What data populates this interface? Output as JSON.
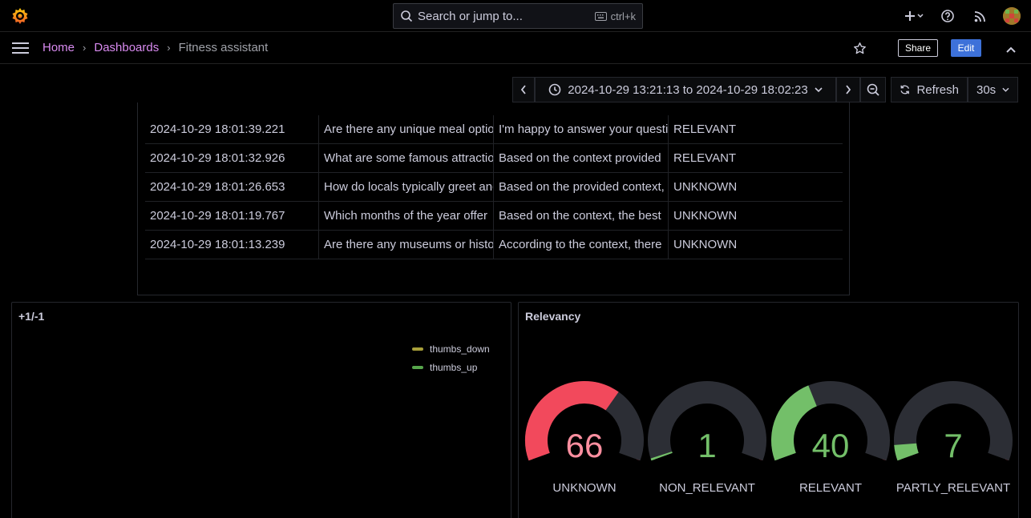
{
  "topbar": {
    "search_placeholder": "Search or jump to...",
    "search_shortcut": "ctrl+k"
  },
  "breadcrumb": {
    "home": "Home",
    "dashboards": "Dashboards",
    "current": "Fitness assistant"
  },
  "toolbar": {
    "share_label": "Share",
    "edit_label": "Edit",
    "time_range": "2024-10-29 13:21:13 to 2024-10-29 18:02:23",
    "refresh_label": "Refresh",
    "refresh_interval": "30s"
  },
  "table": {
    "rows": [
      [
        "2024-10-29 18:01:39.221",
        "Are there any unique meal options",
        "I'm happy to answer your question",
        "RELEVANT"
      ],
      [
        "2024-10-29 18:01:32.926",
        "What are some famous attractions",
        "Based on the context provided",
        "RELEVANT"
      ],
      [
        "2024-10-29 18:01:26.653",
        "How do locals typically greet and",
        "Based on the provided context,",
        "UNKNOWN"
      ],
      [
        "2024-10-29 18:01:19.767",
        "Which months of the year offer",
        "Based on the context, the best",
        "UNKNOWN"
      ],
      [
        "2024-10-29 18:01:13.239",
        "Are there any museums or historic",
        "According to the context, there",
        "UNKNOWN"
      ]
    ]
  },
  "feedback_panel": {
    "title": "+1/-1",
    "legend": [
      {
        "name": "thumbs_down",
        "color": "#a8a03a"
      },
      {
        "name": "thumbs_up",
        "color": "#56a64b"
      }
    ]
  },
  "relevancy_panel": {
    "title": "Relevancy",
    "max": 100,
    "gauges": [
      {
        "label": "UNKNOWN",
        "value": "66",
        "fraction": 0.66,
        "color": "#f2495c"
      },
      {
        "label": "NON_RELEVANT",
        "value": "1",
        "fraction": 0.01,
        "color": "#73bf69"
      },
      {
        "label": "RELEVANT",
        "value": "40",
        "fraction": 0.4,
        "color": "#73bf69"
      },
      {
        "label": "PARTLY_RELEVANT",
        "value": "7",
        "fraction": 0.07,
        "color": "#73bf69"
      }
    ]
  },
  "colors": {
    "accent_link": "#d98bf0",
    "edit_button": "#3d71d9",
    "gauge_green": "#73bf69",
    "gauge_orange": "#ff9830",
    "gauge_red": "#f2495c"
  }
}
